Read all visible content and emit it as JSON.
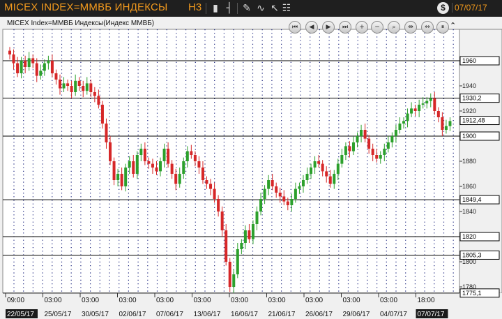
{
  "header": {
    "title": "MICEX INDEX=ММВБ ИНДЕКСЫ",
    "timeframe": "H3",
    "top_date": "07/07/17",
    "dollar_icon": "$"
  },
  "toolbar_icons": [
    "candlestick-icon",
    "bar-chart-icon",
    "pencil-icon",
    "indicator-icon",
    "cursor-icon",
    "settings-icon"
  ],
  "chart_name": "MICEX Index=ММВБ Индексы(Индекс ММВБ)",
  "nav_buttons": [
    {
      "name": "first-icon",
      "glyph": "⏮"
    },
    {
      "name": "back-icon",
      "glyph": "◀"
    },
    {
      "name": "forward-icon",
      "glyph": "▶"
    },
    {
      "name": "last-icon",
      "glyph": "⏭"
    },
    {
      "name": "zoom-in-icon",
      "glyph": "+"
    },
    {
      "name": "zoom-out-icon",
      "glyph": "−"
    },
    {
      "name": "zoom-area-icon",
      "glyph": "⌕"
    },
    {
      "name": "compress-icon",
      "glyph": "⇹"
    },
    {
      "name": "expand-icon",
      "glyph": "⇔"
    },
    {
      "name": "autoscroll-icon",
      "glyph": "⏸"
    }
  ],
  "collapse_glyph": "⌃",
  "colors": {
    "up": "#2ca02c",
    "down": "#d62728",
    "grid": "#1a237e",
    "background": "#ffffff"
  },
  "chart_data": {
    "type": "candlestick",
    "ylim": [
      1775,
      1985
    ],
    "yticks": [
      1780,
      1800,
      1820,
      1840,
      1860,
      1880,
      1900,
      1920,
      1940,
      1960
    ],
    "price_lines": [
      {
        "value": 1960,
        "label": "1960"
      },
      {
        "value": 1930.2,
        "label": "1930,2"
      },
      {
        "value": 1900,
        "label": "1900"
      },
      {
        "value": 1849.4,
        "label": "1849,4"
      },
      {
        "value": 1820,
        "label": "1820"
      },
      {
        "value": 1805.3,
        "label": "1805,3"
      },
      {
        "value": 1775.1,
        "label": "1775,1"
      }
    ],
    "current_price": {
      "value": 1912.48,
      "label": "1912,48"
    },
    "time_labels_top": [
      "09:00",
      "03:00",
      "03:00",
      "03:00",
      "03:00",
      "03:00",
      "03:00",
      "03:00",
      "03:00",
      "03:00",
      "03:00",
      "18:00"
    ],
    "time_labels_bottom": [
      "22/05/17",
      "25/05/17",
      "30/05/17",
      "02/06/17",
      "07/06/17",
      "13/06/17",
      "16/06/17",
      "21/06/17",
      "26/06/17",
      "29/06/17",
      "04/07/17",
      "07/07/17"
    ],
    "closes": [
      1965,
      1958,
      1950,
      1960,
      1955,
      1962,
      1958,
      1948,
      1952,
      1958,
      1960,
      1950,
      1945,
      1938,
      1942,
      1940,
      1935,
      1944,
      1940,
      1936,
      1942,
      1935,
      1932,
      1925,
      1910,
      1895,
      1880,
      1865,
      1870,
      1860,
      1875,
      1880,
      1870,
      1885,
      1890,
      1880,
      1878,
      1875,
      1872,
      1880,
      1890,
      1878,
      1870,
      1862,
      1870,
      1880,
      1888,
      1885,
      1880,
      1875,
      1865,
      1862,
      1858,
      1850,
      1840,
      1825,
      1800,
      1780,
      1790,
      1810,
      1815,
      1825,
      1818,
      1830,
      1840,
      1850,
      1858,
      1865,
      1860,
      1855,
      1852,
      1848,
      1845,
      1850,
      1858,
      1860,
      1865,
      1870,
      1875,
      1880,
      1878,
      1872,
      1868,
      1862,
      1870,
      1878,
      1885,
      1892,
      1888,
      1895,
      1900,
      1905,
      1898,
      1890,
      1885,
      1882,
      1885,
      1890,
      1895,
      1900,
      1905,
      1910,
      1912,
      1918,
      1922,
      1920,
      1925,
      1926,
      1928,
      1930,
      1920,
      1915,
      1905,
      1908,
      1912
    ]
  }
}
